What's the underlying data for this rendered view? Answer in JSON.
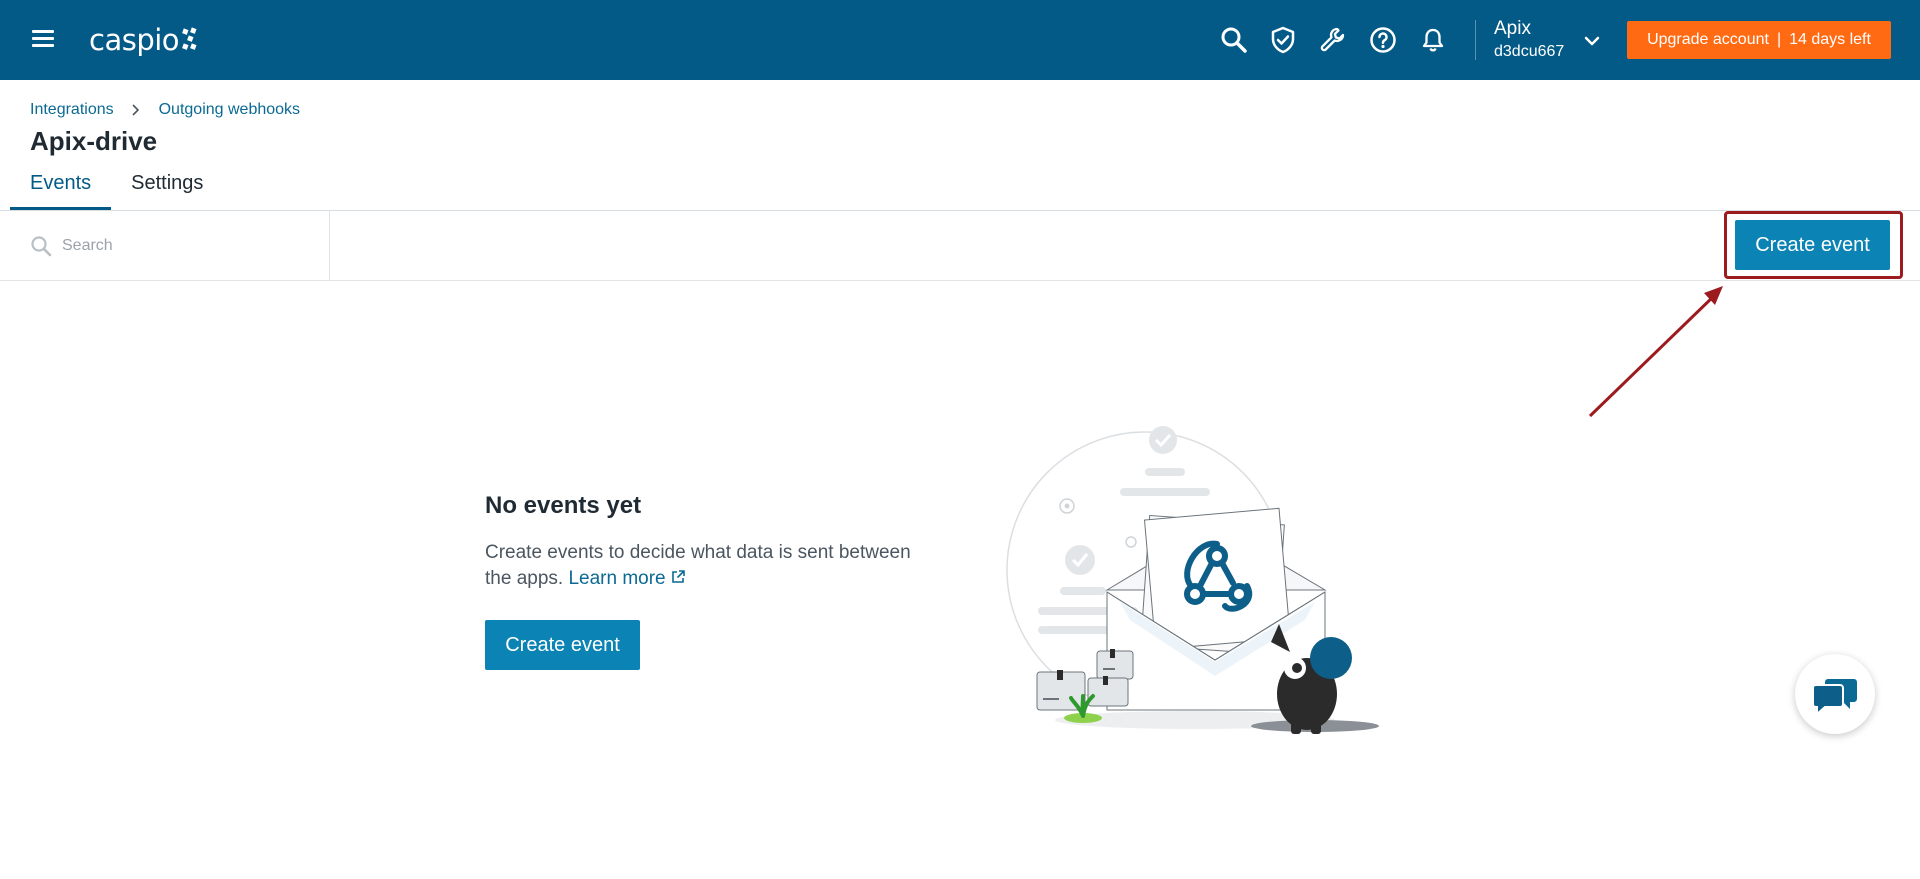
{
  "header": {
    "logo_text": "caspio",
    "account": {
      "name": "Apix",
      "id": "d3dcu667"
    },
    "upgrade": {
      "label": "Upgrade account",
      "separator": "|",
      "trial": "14 days left"
    },
    "colors": {
      "bar": "#035a87",
      "upgrade": "#ff6a13"
    },
    "icons": [
      "menu-icon",
      "search-icon",
      "shield-check-icon",
      "wrench-icon",
      "help-icon",
      "bell-icon",
      "chevron-down-icon"
    ]
  },
  "breadcrumb": {
    "items": [
      "Integrations",
      "Outgoing webhooks"
    ]
  },
  "page": {
    "title": "Apix-drive"
  },
  "tabs": [
    {
      "label": "Events",
      "active": true
    },
    {
      "label": "Settings",
      "active": false
    }
  ],
  "toolbar": {
    "search_placeholder": "Search",
    "create_label": "Create event",
    "accent": "#0b83b4"
  },
  "empty_state": {
    "title": "No events yet",
    "description": "Create events to decide what data is sent between the apps.",
    "learn_more": "Learn more",
    "create_label": "Create event"
  },
  "annotation": {
    "highlight_color": "#9b1b1f"
  }
}
